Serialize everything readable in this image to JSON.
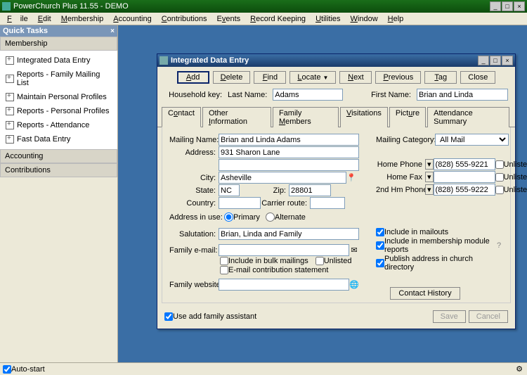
{
  "app": {
    "title": "PowerChurch Plus 11.55 - DEMO"
  },
  "menu": [
    "File",
    "Edit",
    "Membership",
    "Accounting",
    "Contributions",
    "Events",
    "Record Keeping",
    "Utilities",
    "Window",
    "Help"
  ],
  "sidebar": {
    "title": "Quick Tasks",
    "sections": {
      "membership": {
        "head": "Membership",
        "items": [
          "Integrated Data Entry",
          "Reports - Family Mailing List",
          "Maintain Personal Profiles",
          "Reports - Personal Profiles",
          "Reports - Attendance",
          "Fast Data Entry"
        ]
      },
      "accounting": {
        "head": "Accounting"
      },
      "contributions": {
        "head": "Contributions"
      }
    }
  },
  "child": {
    "title": "Integrated Data Entry",
    "toolbar": {
      "add": "Add",
      "delete": "Delete",
      "find": "Find",
      "locate": "Locate",
      "next": "Next",
      "previous": "Previous",
      "tag": "Tag",
      "close": "Close"
    },
    "header": {
      "hk": "Household key:",
      "ln": "Last Name:",
      "fn": "First Name:",
      "lastName": "Adams",
      "firstName": "Brian and Linda"
    },
    "tabs": [
      "Contact",
      "Other Information",
      "Family Members",
      "Visitations",
      "Picture",
      "Attendance Summary"
    ],
    "contact": {
      "labels": {
        "mailingName": "Mailing Name:",
        "address": "Address:",
        "city": "City:",
        "state": "State:",
        "zip": "Zip:",
        "country": "Country:",
        "carrier": "Carrier route:",
        "addrInUse": "Address in use:",
        "primary": "Primary",
        "alternate": "Alternate",
        "salutation": "Salutation:",
        "familyEmail": "Family e-mail:",
        "familyWeb": "Family website:",
        "includeBulk": "Include in bulk mailings",
        "unlisted": "Unlisted",
        "emailContrib": "E-mail contribution statement",
        "mailingCat": "Mailing Category:",
        "homePhone": "Home Phone",
        "homeFax": "Home Fax",
        "hm2": "2nd Hm Phone",
        "includeMailouts": "Include in mailouts",
        "includeMod": "Include in membership module reports",
        "publish": "Publish address in church directory",
        "contactHistory": "Contact History"
      },
      "values": {
        "mailingName": "Brian and Linda Adams",
        "addr1": "931 Sharon Lane",
        "addr2": "",
        "city": "Asheville",
        "state": "NC",
        "zip": "28801",
        "country": "",
        "carrier": "",
        "salutation": "Brian, Linda and Family",
        "email": "",
        "website": "",
        "mailingCat": "All Mail",
        "homePhone": "(828) 555-9221",
        "homeFax": "",
        "hm2": "(828) 555-9222"
      },
      "checks": {
        "mailouts": true,
        "moduleReports": true,
        "publish": true,
        "bulk": false,
        "unlistedMail": false,
        "emailContrib": false,
        "unlistedPh1": false,
        "unlistedPh2": false,
        "unlistedPh3": false
      }
    },
    "footer": {
      "useAdd": "Use add family assistant",
      "save": "Save",
      "cancel": "Cancel",
      "useAddChecked": true
    }
  },
  "status": {
    "autostart": "Auto-start"
  }
}
